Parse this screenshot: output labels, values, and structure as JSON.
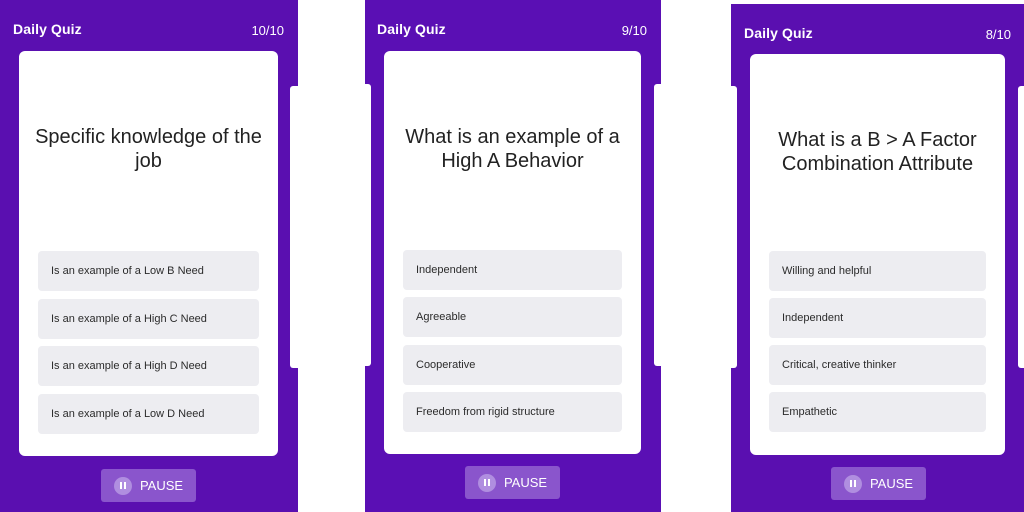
{
  "colors": {
    "background_purple": "#5a0fb0",
    "card": "#ffffff",
    "option_bg": "#ededf1",
    "pause_button": "#8a55cc"
  },
  "screens": [
    {
      "header": {
        "title": "Daily Quiz",
        "progress": "10/10"
      },
      "question": "Specific knowledge of the job",
      "options": [
        "Is an example of a Low B Need",
        "Is an example of a High C Need",
        "Is an example of a High D Need",
        "Is an example of a Low D Need"
      ],
      "pause_label": "PAUSE"
    },
    {
      "header": {
        "title": "Daily Quiz",
        "progress": "9/10"
      },
      "question": "What is an example of a High A Behavior",
      "options": [
        "Independent",
        "Agreeable",
        "Cooperative",
        "Freedom from rigid structure"
      ],
      "pause_label": "PAUSE"
    },
    {
      "header": {
        "title": "Daily Quiz",
        "progress": "8/10"
      },
      "question": "What is a B > A Factor Combination Attribute",
      "options": [
        "Willing and helpful",
        "Independent",
        "Critical, creative thinker",
        "Empathetic"
      ],
      "pause_label": "PAUSE"
    }
  ]
}
